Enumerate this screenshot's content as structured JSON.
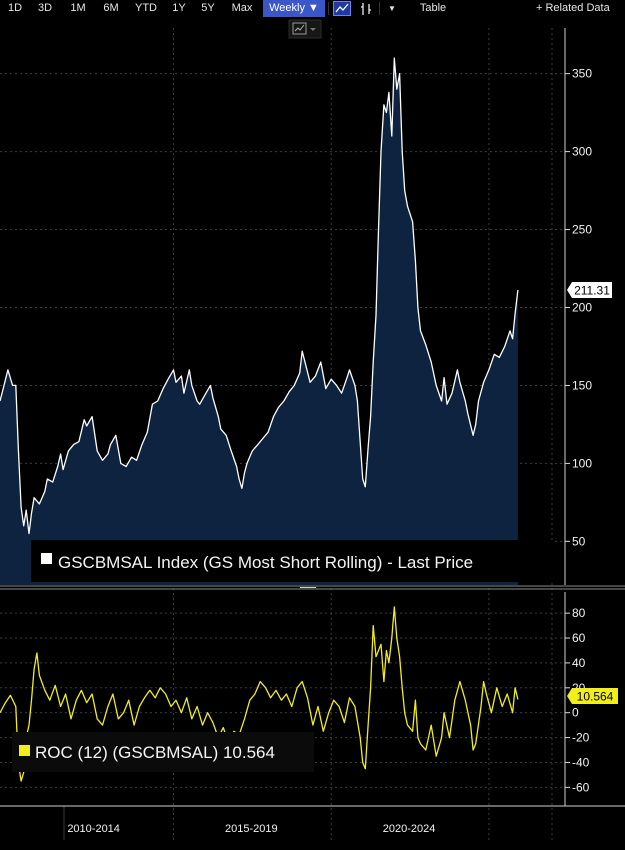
{
  "toolbar": {
    "ranges": [
      "1D",
      "3D",
      "1M",
      "6M",
      "YTD",
      "1Y",
      "5Y",
      "Max"
    ],
    "frequency": "Weekly ▼",
    "table_label": "Table",
    "related_label": "+ Related Data"
  },
  "colors": {
    "price_line": "#ffffff",
    "price_fill": "#0d2340",
    "roc_line": "#f1ee1a",
    "grid": "#3c3c3c",
    "active_button": "#3a56c8"
  },
  "chart_data": [
    {
      "type": "area",
      "title": "GSCBMSAL Index (GS Most Short Rolling) - Last Price",
      "legend": "GSCBMSAL Index (GS Most Short Rolling) - Last Price",
      "last_value_label": "211.31",
      "y_ticks": [
        50,
        100,
        150,
        200,
        250,
        300,
        350
      ],
      "ylim": [
        22,
        378
      ],
      "xlim": [
        2008.5,
        2026.0
      ],
      "x_tick_labels": [
        "2010-2014",
        "2015-2019",
        "2020-2024"
      ],
      "points": [
        [
          2008.5,
          140
        ],
        [
          2008.6,
          148
        ],
        [
          2008.75,
          160
        ],
        [
          2008.9,
          150
        ],
        [
          2009.0,
          150
        ],
        [
          2009.08,
          110
        ],
        [
          2009.17,
          72
        ],
        [
          2009.25,
          60
        ],
        [
          2009.33,
          70
        ],
        [
          2009.42,
          55
        ],
        [
          2009.5,
          68
        ],
        [
          2009.58,
          78
        ],
        [
          2009.75,
          74
        ],
        [
          2009.92,
          82
        ],
        [
          2010.0,
          90
        ],
        [
          2010.17,
          88
        ],
        [
          2010.33,
          98
        ],
        [
          2010.42,
          106
        ],
        [
          2010.5,
          96
        ],
        [
          2010.67,
          108
        ],
        [
          2010.83,
          112
        ],
        [
          2011.0,
          114
        ],
        [
          2011.17,
          128
        ],
        [
          2011.25,
          124
        ],
        [
          2011.42,
          130
        ],
        [
          2011.58,
          108
        ],
        [
          2011.75,
          102
        ],
        [
          2011.92,
          106
        ],
        [
          2012.0,
          112
        ],
        [
          2012.17,
          118
        ],
        [
          2012.33,
          100
        ],
        [
          2012.5,
          98
        ],
        [
          2012.67,
          104
        ],
        [
          2012.83,
          102
        ],
        [
          2013.0,
          112
        ],
        [
          2013.17,
          120
        ],
        [
          2013.33,
          138
        ],
        [
          2013.5,
          140
        ],
        [
          2013.67,
          148
        ],
        [
          2013.83,
          154
        ],
        [
          2014.0,
          160
        ],
        [
          2014.08,
          152
        ],
        [
          2014.25,
          156
        ],
        [
          2014.33,
          145
        ],
        [
          2014.5,
          160
        ],
        [
          2014.58,
          150
        ],
        [
          2014.75,
          140
        ],
        [
          2014.83,
          138
        ],
        [
          2015.0,
          144
        ],
        [
          2015.17,
          150
        ],
        [
          2015.25,
          142
        ],
        [
          2015.42,
          130
        ],
        [
          2015.5,
          122
        ],
        [
          2015.67,
          118
        ],
        [
          2015.83,
          108
        ],
        [
          2016.0,
          98
        ],
        [
          2016.08,
          90
        ],
        [
          2016.17,
          84
        ],
        [
          2016.25,
          94
        ],
        [
          2016.33,
          100
        ],
        [
          2016.5,
          108
        ],
        [
          2016.67,
          112
        ],
        [
          2016.83,
          116
        ],
        [
          2017.0,
          120
        ],
        [
          2017.17,
          130
        ],
        [
          2017.33,
          136
        ],
        [
          2017.5,
          140
        ],
        [
          2017.67,
          146
        ],
        [
          2017.83,
          150
        ],
        [
          2018.0,
          158
        ],
        [
          2018.08,
          172
        ],
        [
          2018.17,
          165
        ],
        [
          2018.33,
          152
        ],
        [
          2018.5,
          156
        ],
        [
          2018.67,
          165
        ],
        [
          2018.83,
          148
        ],
        [
          2019.0,
          154
        ],
        [
          2019.17,
          150
        ],
        [
          2019.33,
          145
        ],
        [
          2019.5,
          155
        ],
        [
          2019.58,
          160
        ],
        [
          2019.75,
          150
        ],
        [
          2019.83,
          140
        ],
        [
          2020.0,
          90
        ],
        [
          2020.08,
          85
        ],
        [
          2020.17,
          110
        ],
        [
          2020.25,
          130
        ],
        [
          2020.33,
          165
        ],
        [
          2020.42,
          195
        ],
        [
          2020.5,
          250
        ],
        [
          2020.58,
          300
        ],
        [
          2020.67,
          330
        ],
        [
          2020.75,
          325
        ],
        [
          2020.83,
          338
        ],
        [
          2020.92,
          310
        ],
        [
          2021.0,
          360
        ],
        [
          2021.08,
          340
        ],
        [
          2021.17,
          350
        ],
        [
          2021.25,
          300
        ],
        [
          2021.33,
          275
        ],
        [
          2021.42,
          265
        ],
        [
          2021.58,
          255
        ],
        [
          2021.67,
          230
        ],
        [
          2021.75,
          200
        ],
        [
          2021.83,
          185
        ],
        [
          2022.0,
          176
        ],
        [
          2022.17,
          165
        ],
        [
          2022.33,
          150
        ],
        [
          2022.5,
          140
        ],
        [
          2022.58,
          155
        ],
        [
          2022.67,
          138
        ],
        [
          2022.83,
          145
        ],
        [
          2023.0,
          160
        ],
        [
          2023.08,
          152
        ],
        [
          2023.25,
          140
        ],
        [
          2023.33,
          132
        ],
        [
          2023.5,
          118
        ],
        [
          2023.58,
          125
        ],
        [
          2023.67,
          140
        ],
        [
          2023.83,
          152
        ],
        [
          2024.0,
          160
        ],
        [
          2024.17,
          170
        ],
        [
          2024.33,
          168
        ],
        [
          2024.5,
          175
        ],
        [
          2024.67,
          185
        ],
        [
          2024.75,
          180
        ],
        [
          2024.83,
          196
        ],
        [
          2024.92,
          211.31
        ]
      ]
    },
    {
      "type": "line",
      "title": "ROC (12) (GSCBMSAL)",
      "legend": "ROC (12) (GSCBMSAL) 10.564",
      "last_value_label": "10.564",
      "y_ticks": [
        -60,
        -40,
        -20,
        0,
        20,
        40,
        60,
        80
      ],
      "ylim": [
        -75,
        97
      ],
      "xlim": [
        2008.5,
        2026.0
      ],
      "points": [
        [
          2008.5,
          0
        ],
        [
          2008.67,
          8
        ],
        [
          2008.83,
          14
        ],
        [
          2009.0,
          5
        ],
        [
          2009.08,
          -40
        ],
        [
          2009.17,
          -55
        ],
        [
          2009.25,
          -48
        ],
        [
          2009.33,
          -20
        ],
        [
          2009.42,
          -10
        ],
        [
          2009.5,
          10
        ],
        [
          2009.58,
          35
        ],
        [
          2009.67,
          48
        ],
        [
          2009.75,
          30
        ],
        [
          2009.92,
          18
        ],
        [
          2010.08,
          10
        ],
        [
          2010.25,
          22
        ],
        [
          2010.42,
          5
        ],
        [
          2010.58,
          15
        ],
        [
          2010.75,
          -5
        ],
        [
          2010.92,
          10
        ],
        [
          2011.08,
          18
        ],
        [
          2011.25,
          8
        ],
        [
          2011.42,
          15
        ],
        [
          2011.58,
          -5
        ],
        [
          2011.75,
          -10
        ],
        [
          2011.92,
          5
        ],
        [
          2012.08,
          15
        ],
        [
          2012.25,
          -5
        ],
        [
          2012.42,
          0
        ],
        [
          2012.58,
          10
        ],
        [
          2012.75,
          -10
        ],
        [
          2012.92,
          5
        ],
        [
          2013.08,
          12
        ],
        [
          2013.25,
          18
        ],
        [
          2013.42,
          12
        ],
        [
          2013.58,
          20
        ],
        [
          2013.75,
          15
        ],
        [
          2013.92,
          5
        ],
        [
          2014.08,
          10
        ],
        [
          2014.25,
          0
        ],
        [
          2014.42,
          12
        ],
        [
          2014.58,
          -5
        ],
        [
          2014.75,
          5
        ],
        [
          2014.92,
          -10
        ],
        [
          2015.08,
          0
        ],
        [
          2015.25,
          -8
        ],
        [
          2015.42,
          -20
        ],
        [
          2015.58,
          -12
        ],
        [
          2015.75,
          -25
        ],
        [
          2015.92,
          -15
        ],
        [
          2016.08,
          -18
        ],
        [
          2016.25,
          -5
        ],
        [
          2016.42,
          10
        ],
        [
          2016.58,
          15
        ],
        [
          2016.75,
          25
        ],
        [
          2016.92,
          20
        ],
        [
          2017.08,
          12
        ],
        [
          2017.25,
          18
        ],
        [
          2017.42,
          10
        ],
        [
          2017.58,
          15
        ],
        [
          2017.75,
          5
        ],
        [
          2017.92,
          20
        ],
        [
          2018.08,
          25
        ],
        [
          2018.25,
          12
        ],
        [
          2018.42,
          -10
        ],
        [
          2018.58,
          5
        ],
        [
          2018.75,
          -15
        ],
        [
          2018.92,
          0
        ],
        [
          2019.08,
          10
        ],
        [
          2019.25,
          5
        ],
        [
          2019.42,
          -8
        ],
        [
          2019.58,
          12
        ],
        [
          2019.75,
          5
        ],
        [
          2019.92,
          -20
        ],
        [
          2020.0,
          -40
        ],
        [
          2020.08,
          -45
        ],
        [
          2020.17,
          -10
        ],
        [
          2020.25,
          20
        ],
        [
          2020.33,
          70
        ],
        [
          2020.42,
          45
        ],
        [
          2020.58,
          55
        ],
        [
          2020.67,
          25
        ],
        [
          2020.75,
          50
        ],
        [
          2020.83,
          40
        ],
        [
          2020.92,
          60
        ],
        [
          2021.0,
          85
        ],
        [
          2021.08,
          60
        ],
        [
          2021.17,
          45
        ],
        [
          2021.25,
          20
        ],
        [
          2021.33,
          0
        ],
        [
          2021.42,
          -10
        ],
        [
          2021.58,
          -15
        ],
        [
          2021.67,
          10
        ],
        [
          2021.75,
          -20
        ],
        [
          2021.83,
          -25
        ],
        [
          2022.0,
          -30
        ],
        [
          2022.17,
          -10
        ],
        [
          2022.33,
          -35
        ],
        [
          2022.5,
          -20
        ],
        [
          2022.58,
          0
        ],
        [
          2022.75,
          -20
        ],
        [
          2022.92,
          10
        ],
        [
          2023.08,
          25
        ],
        [
          2023.25,
          10
        ],
        [
          2023.42,
          -10
        ],
        [
          2023.5,
          -30
        ],
        [
          2023.58,
          -25
        ],
        [
          2023.75,
          5
        ],
        [
          2023.83,
          25
        ],
        [
          2023.92,
          15
        ],
        [
          2024.08,
          0
        ],
        [
          2024.25,
          20
        ],
        [
          2024.42,
          5
        ],
        [
          2024.58,
          15
        ],
        [
          2024.75,
          0
        ],
        [
          2024.83,
          20
        ],
        [
          2024.92,
          10.564
        ]
      ]
    }
  ]
}
